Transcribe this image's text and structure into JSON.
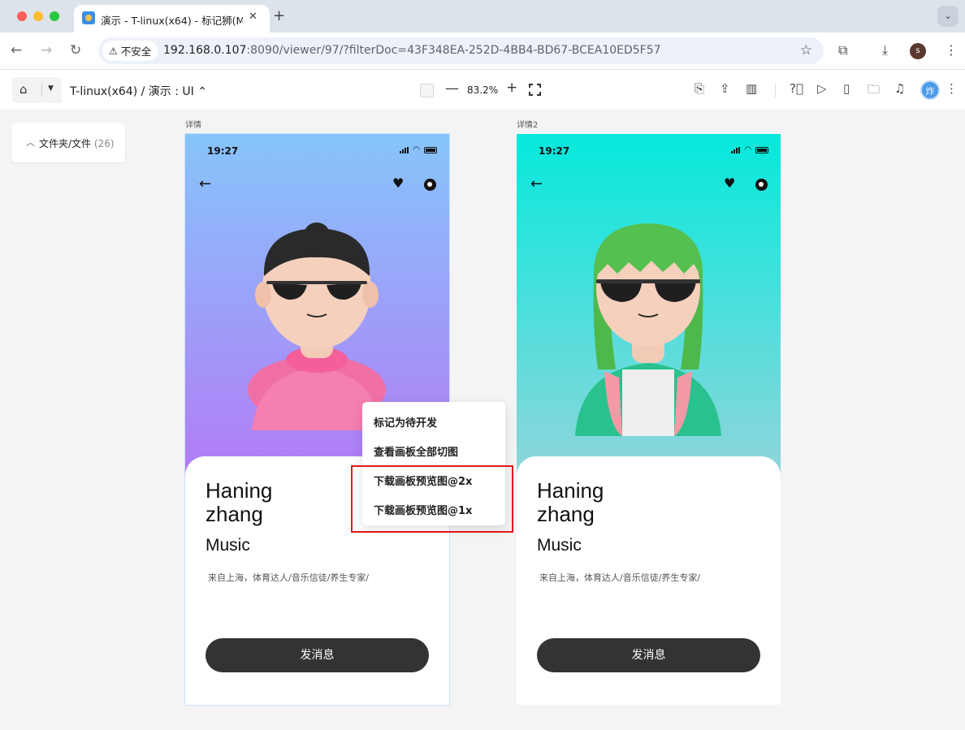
{
  "browser": {
    "tab_title": "演示 - T-linux(x64) - 标记狮(M",
    "tab_close": "✕",
    "new_tab": "+",
    "security_label": "不安全",
    "url_host": "192.168.0.107",
    "url_rest": ":8090/viewer/97/?filterDoc=43F348EA-252D-4BB4-BD67-BCEA10ED5F57",
    "profile_initial": "s"
  },
  "appbar": {
    "breadcrumb": "T-linux(x64)  /  演示 : UI ⌃",
    "zoom": "83.2%",
    "avatar_text": "炸"
  },
  "sidebar": {
    "folder_label": "文件夹/文件",
    "folder_count": "(26)"
  },
  "artboards": [
    {
      "label": "详情",
      "time": "19:27",
      "name_line1": "Haning",
      "name_line2": "zhang",
      "role": "Music",
      "description": "来自上海，体育达人/音乐信徒/养生专家/",
      "button": "发消息",
      "gradient_top": "#86c5fb",
      "gradient_bottom": "#b27cf6"
    },
    {
      "label": "详情2",
      "time": "19:27",
      "name_line1": "Haning",
      "name_line2": "zhang",
      "role": "Music",
      "description": "来自上海，体育达人/音乐信徒/养生专家/",
      "button": "发消息",
      "gradient_top": "#06e9dc",
      "gradient_bottom": "#8fd5db"
    }
  ],
  "context_menu": {
    "items": [
      "标记为待开发",
      "查看画板全部切图",
      "下载画板预览图@2x",
      "下载画板预览图@1x"
    ]
  },
  "colors": {
    "highlight": "#e0191c",
    "button": "#333333",
    "avatar": "#4a9be8"
  }
}
